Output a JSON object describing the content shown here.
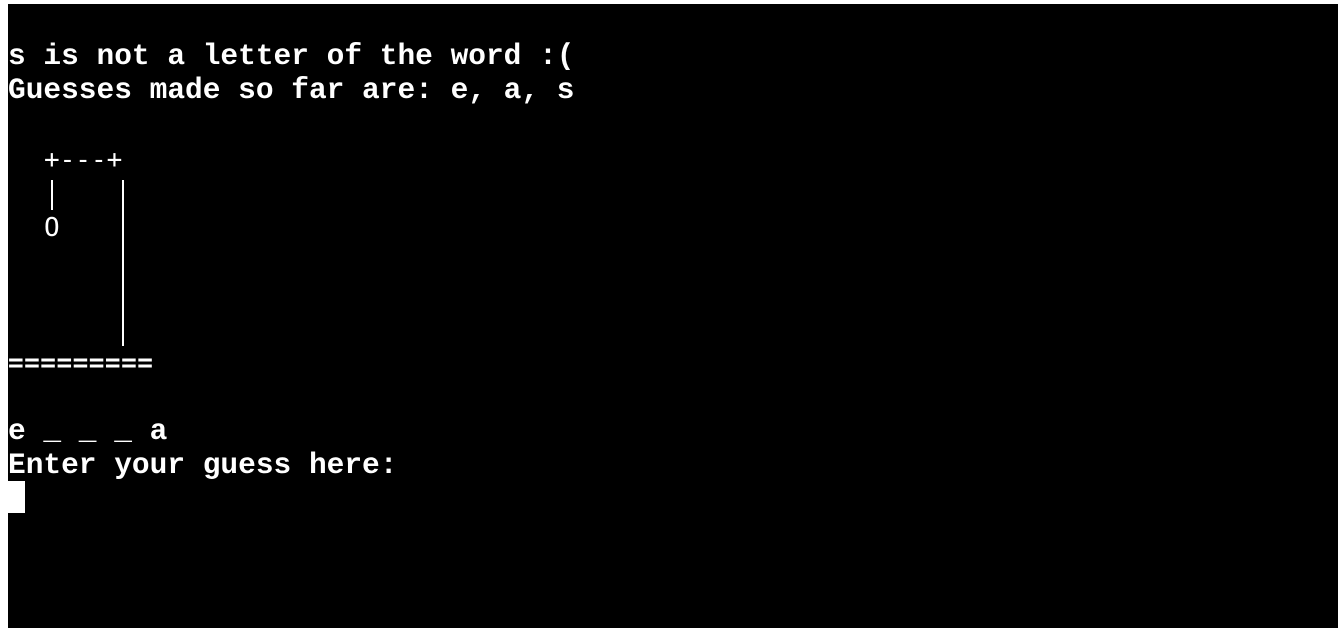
{
  "terminal": {
    "message_line": "s is not a letter of the word :(",
    "guesses_line": "Guesses made so far are: e, a, s",
    "gallows": {
      "top_beam": "+---+",
      "head": "O",
      "base": "========="
    },
    "word_progress": "e _ _ _ a",
    "prompt": "Enter your guess here:",
    "colors": {
      "background": "#000000",
      "text": "#ffffff",
      "cursor": "#ffffff"
    }
  }
}
